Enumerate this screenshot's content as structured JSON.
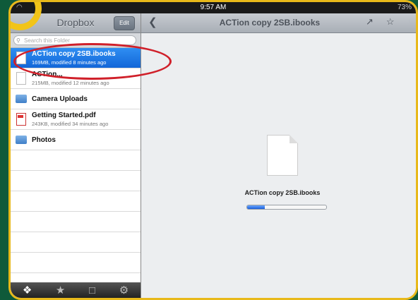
{
  "status_bar": {
    "time": "9:57 AM",
    "battery": "73%"
  },
  "sidebar": {
    "title": "Dropbox",
    "edit_label": "Edit",
    "search_placeholder": "Search this Folder",
    "items": [
      {
        "name": "ACTion copy 2SB.ibooks",
        "meta": "169MB, modified 8 minutes ago",
        "icon": "document-icon",
        "selected": true
      },
      {
        "name": "ACTion...",
        "meta": "215MB, modified 12 minutes ago",
        "icon": "document-icon",
        "selected": false
      },
      {
        "name": "Camera Uploads",
        "meta": "",
        "icon": "folder-icon",
        "selected": false
      },
      {
        "name": "Getting Started.pdf",
        "meta": "243KB, modified 34 minutes ago",
        "icon": "pdf-icon",
        "selected": false
      },
      {
        "name": "Photos",
        "meta": "",
        "icon": "folder-icon",
        "selected": false
      }
    ],
    "tabs": [
      "dropbox-icon",
      "star-icon",
      "upload-icon",
      "gear-icon"
    ]
  },
  "main": {
    "title": "ACTion copy 2SB.ibooks",
    "file_name": "ACTion copy 2SB.ibooks",
    "progress": 0.22
  },
  "colors": {
    "highlight": "#1a6fe0",
    "annotation_circle": "#d0202a",
    "frame": "#e8b91a"
  }
}
